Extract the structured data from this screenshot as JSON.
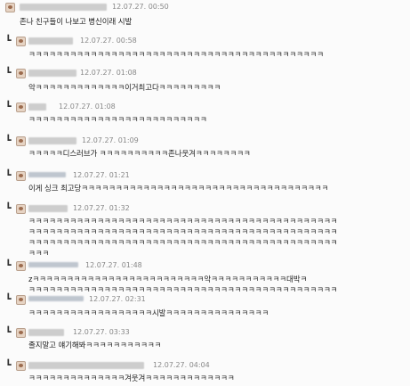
{
  "comments": [
    {
      "timestamp": "12.07.27. 00:50",
      "lines": [
        "존나 친구들이 나보고 병신이래 시발"
      ]
    },
    {
      "timestamp": "12.07.27. 00:58",
      "lines": [
        "ㅋㅋㅋㅋㅋㅋㅋㅋㅋㅋㅋㅋㅋㅋㅋㅋㅋㅋㅋㅋㅋㅋㅋㅋㅋㅋㅋㅋㅋㅋㅋㅋㅋㅋㅋㅋㅋㅋㅋㅋㅋㅋㅋ"
      ]
    },
    {
      "timestamp": "12.07.27. 01:08",
      "lines": [
        "악ㅋㅋㅋㅋㅋㅋㅋㅋㅋㅋㅋㅋㅋ이거최고다ㅋㅋㅋㅋㅋㅋㅋㅋㅋ"
      ]
    },
    {
      "timestamp": "12.07.27. 01:08",
      "lines": [
        "ㅋㅋㅋㅋㅋㅋㅋㅋㅋㅋㅋㅋㅋㅋㅋㅋㅋㅋㅋㅋㅋㅋㅋㅋㅋㅋ"
      ]
    },
    {
      "timestamp": "12.07.27. 01:09",
      "lines": [
        "ㅋㅋㅋㅋㅋ디스러브가 ㅋㅋㅋㅋㅋㅋㅋㅋㅋㅋ존나웃겨ㅋㅋㅋㅋㅋㅋㅋㅋ"
      ]
    },
    {
      "timestamp": "12.07.27. 01:21",
      "lines": [
        "이게 싱크 최고당ㅋㅋㅋㅋㅋㅋㅋㅋㅋㅋㅋㅋㅋㅋㅋㅋㅋㅋㅋㅋㅋㅋㅋㅋㅋㅋㅋㅋㅋㅋㅋㅋㅋㅋㅋㅋ"
      ]
    },
    {
      "timestamp": "12.07.27. 01:32",
      "lines": [
        "ㅋㅋㅋㅋㅋㅋㅋㅋㅋㅋㅋㅋㅋㅋㅋㅋㅋㅋㅋㅋㅋㅋㅋㅋㅋㅋㅋㅋㅋㅋㅋㅋㅋㅋㅋㅋㅋㅋㅋㅋㅋㅋㅋㅋㅋ",
        "ㅋㅋㅋㅋㅋㅋㅋㅋㅋㅋㅋㅋㅋㅋㅋㅋㅋㅋㅋㅋㅋㅋㅋㅋㅋㅋㅋㅋㅋㅋㅋㅋㅋㅋㅋㅋㅋㅋㅋㅋㅋㅋㅋㅋㅋ",
        "ㅋㅋㅋㅋㅋㅋㅋㅋㅋㅋㅋㅋㅋㅋㅋㅋㅋㅋㅋㅋㅋㅋㅋㅋㅋㅋㅋㅋㅋㅋㅋㅋㅋㅋㅋㅋㅋㅋㅋㅋㅋㅋㅋㅋㅋ",
        "ㅋㅋㅋ"
      ]
    },
    {
      "timestamp": "12.07.27. 01:48",
      "lines": [
        "zㅋㅋㅋㅋㅋㅋㅋㅋㅋㅋㅋㅋㅋㅋㅋㅋㅋㅋㅋㅋㅋㅋㅋㅋㅋ악ㅋㅋㅋㅋㅋㅋㅋㅋㅋㅋㅋ대박ㅋ",
        "ㅋㅋㅋㅋㅋㅋㅋㅋㅋㅋㅋㅋㅋㅋㅋㅋㅋㅋㅋㅋㅋㅋㅋㅋㅋㅋㅋㅋㅋㅋㅋㅋㅋㅋㅋㅋㅋㅋㅋㅋㅋㅋㅋㅋㅋ"
      ]
    },
    {
      "timestamp": "12.07.27. 02:31",
      "lines": [
        "ㅋㅋㅋㅋㅋㅋㅋㅋㅋㅋㅋㅋㅋㅋㅋㅋㅋㅋ시발ㅋㅋㅋㅋㅋㅋㅋㅋㅋㅋㅋㅋㅋㅋㅋ"
      ]
    },
    {
      "timestamp": "12.07.27. 03:33",
      "lines": [
        "졸지말고 얘기해봐ㅋㅋㅋㅋㅋㅋㅋㅋㅋㅋㅋ"
      ]
    },
    {
      "timestamp": "12.07.27. 04:04",
      "lines": [
        "ㅋㅋㅋㅋㅋㅋㅋㅋㅋㅋㅋㅋㅋㅋ겨웃겨ㅋㅋㅋㅋㅋㅋㅋㅋㅋㅋㅋㅋㅋ"
      ]
    }
  ]
}
